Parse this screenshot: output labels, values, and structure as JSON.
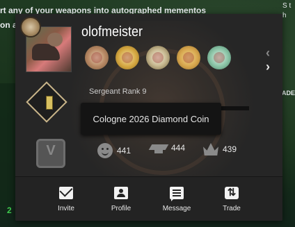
{
  "background": {
    "headline": "rt any of your weapons into autographed mementos",
    "subline": "on a",
    "right_fragment": "S t h",
    "right_fragment_2": "EADE",
    "left_number": "2"
  },
  "profile": {
    "username": "olofmeister",
    "rank_text": "Sergeant Rank 9",
    "tooltip": "Cologne 2026 Diamond Coin"
  },
  "coins": [
    {
      "icon": "coin-1-icon"
    },
    {
      "icon": "coin-2-icon"
    },
    {
      "icon": "coin-3-icon"
    },
    {
      "icon": "coin-4-icon"
    },
    {
      "icon": "coin-5-icon"
    }
  ],
  "stats": {
    "friendly": "441",
    "teacher": "444",
    "leader": "439"
  },
  "actions": {
    "invite": "Invite",
    "profile": "Profile",
    "message": "Message",
    "trade": "Trade"
  },
  "colors": {
    "card": "#262626",
    "tooltip": "#141414",
    "accent_green": "#3fcf4f"
  }
}
